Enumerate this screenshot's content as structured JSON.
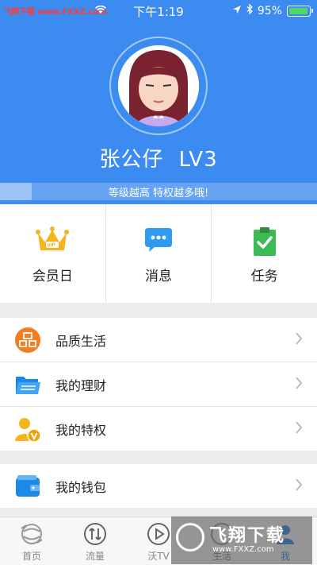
{
  "status_bar": {
    "watermark": "飞翔下载 www.FXXZ.com",
    "time": "下午1:19",
    "battery": "95%",
    "battery_level": 0.95
  },
  "profile": {
    "username": "张公仔",
    "level": "LV3",
    "level_hint": "等级越高 特权越多哦!",
    "level_progress": 0.1
  },
  "quick_actions": [
    {
      "label": "会员日",
      "icon": "crown-vip-icon"
    },
    {
      "label": "消息",
      "icon": "chat-bubble-icon"
    },
    {
      "label": "任务",
      "icon": "task-clipboard-icon"
    }
  ],
  "menu_group_1": [
    {
      "label": "品质生活",
      "icon": "pin-badge-icon"
    },
    {
      "label": "我的理财",
      "icon": "folder-icon"
    },
    {
      "label": "我的特权",
      "icon": "privilege-user-icon"
    }
  ],
  "menu_group_2": [
    {
      "label": "我的钱包",
      "icon": "wallet-icon"
    }
  ],
  "tabs": [
    {
      "label": "首页",
      "icon": "home-globe-icon"
    },
    {
      "label": "流量",
      "icon": "traffic-arrows-icon"
    },
    {
      "label": "沃TV",
      "icon": "play-icon"
    },
    {
      "label": "生活",
      "icon": "life-icon"
    },
    {
      "label": "我",
      "icon": "me-icon",
      "active": true
    }
  ],
  "watermark_overlay": {
    "title": "飞翔下载",
    "url": "www.FXXZ.com"
  },
  "colors": {
    "brand_blue": "#3b8bf0",
    "vip_gold": "#f5b31c",
    "task_green": "#3cba54",
    "orange": "#f57c1f"
  }
}
